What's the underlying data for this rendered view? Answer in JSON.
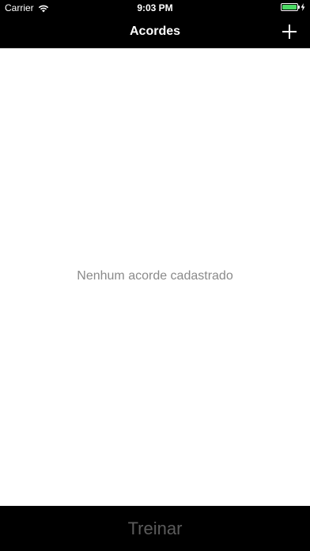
{
  "status_bar": {
    "carrier": "Carrier",
    "time": "9:03 PM",
    "wifi_icon": "wifi-icon",
    "battery_icon": "battery-icon",
    "battery_level": 1.0,
    "battery_color": "#4cd964",
    "charging_icon": "charging-bolt-icon"
  },
  "nav_bar": {
    "title": "Acordes",
    "add_icon": "plus-icon"
  },
  "content": {
    "empty_message": "Nenhum acorde cadastrado"
  },
  "bottom_button": {
    "label": "Treinar"
  }
}
